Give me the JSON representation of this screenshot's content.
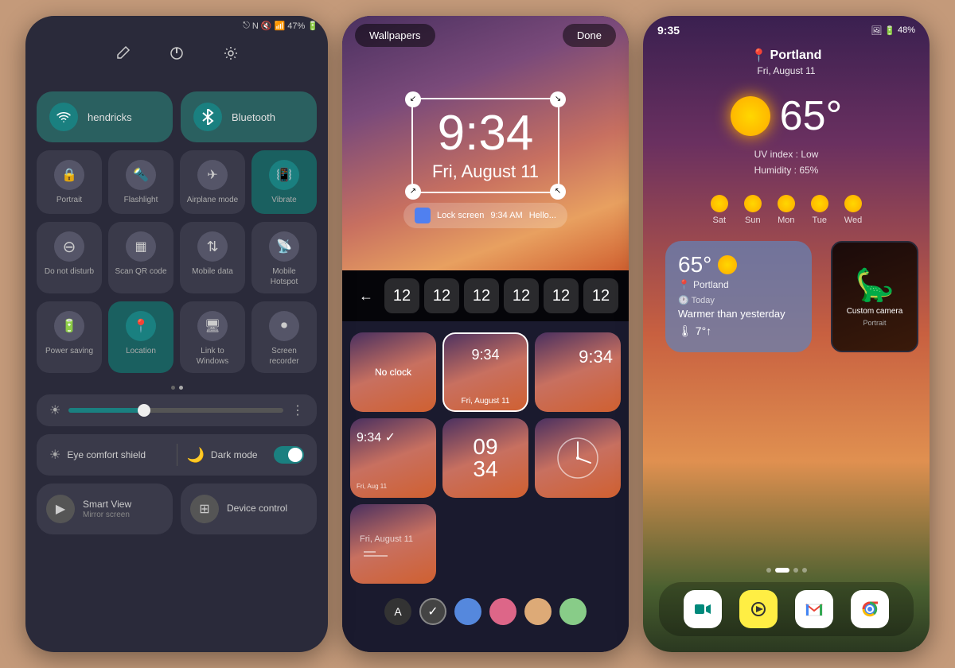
{
  "phone1": {
    "status": {
      "battery": "47%",
      "icons": [
        "bluetooth",
        "nfc",
        "mute",
        "signal",
        "battery"
      ]
    },
    "toolbar": {
      "edit_label": "✏",
      "power_label": "⏻",
      "settings_label": "⚙"
    },
    "tiles_top": [
      {
        "id": "wifi",
        "label": "hendricks",
        "active": true,
        "icon": "wifi"
      },
      {
        "id": "bluetooth",
        "label": "Bluetooth",
        "active": true,
        "icon": "bluetooth"
      }
    ],
    "tiles_row1": [
      {
        "id": "portrait",
        "label": "Portrait",
        "active": false,
        "icon": "🔒"
      },
      {
        "id": "flashlight",
        "label": "Flashlight",
        "active": false,
        "icon": "🔦"
      },
      {
        "id": "airplane",
        "label": "Airplane mode",
        "active": false,
        "icon": "✈"
      },
      {
        "id": "vibrate",
        "label": "Vibrate",
        "active": true,
        "icon": "📳"
      }
    ],
    "tiles_row2": [
      {
        "id": "dnd",
        "label": "Do not disturb",
        "active": false,
        "icon": "⊖"
      },
      {
        "id": "qr",
        "label": "Scan QR code",
        "active": false,
        "icon": "▦"
      },
      {
        "id": "data",
        "label": "Mobile data",
        "active": false,
        "icon": "↕"
      },
      {
        "id": "hotspot",
        "label": "Mobile Hotspot",
        "active": false,
        "icon": "📶"
      }
    ],
    "tiles_row3": [
      {
        "id": "power",
        "label": "Power saving",
        "active": false,
        "icon": "🔋"
      },
      {
        "id": "location",
        "label": "Location",
        "active": true,
        "icon": "📍"
      },
      {
        "id": "link",
        "label": "Link to Windows",
        "active": false,
        "icon": "🖥"
      },
      {
        "id": "recorder",
        "label": "Screen recorder",
        "active": false,
        "icon": "⏺"
      }
    ],
    "brightness": {
      "level": 35,
      "dots": [
        false,
        true
      ]
    },
    "comfort": {
      "eye_label": "Eye comfort shield",
      "dark_label": "Dark mode"
    },
    "bottom": [
      {
        "id": "smart_view",
        "label": "Smart View",
        "sub": "Mirror screen",
        "icon": "▶"
      },
      {
        "id": "device_control",
        "label": "Device control",
        "icon": "⊞"
      }
    ]
  },
  "phone2": {
    "top_bar": {
      "wallpapers_label": "Wallpapers",
      "done_label": "Done"
    },
    "clock_display": {
      "time": "9:34",
      "date": "Fri, August 11"
    },
    "lockscreen_notif": {
      "app": "Lock screen",
      "time": "9:34 AM",
      "text": "Hello..."
    },
    "scroll_numbers": [
      "12",
      "12",
      "12",
      "12",
      "12",
      "12"
    ],
    "clock_options": [
      {
        "id": "no_clock",
        "label": "No clock",
        "type": "empty"
      },
      {
        "id": "digital1",
        "label": "",
        "time": "9:34",
        "date": "Fri, August 11",
        "type": "digital_small"
      },
      {
        "id": "digital2",
        "label": "",
        "time": "9:34",
        "type": "digital_right"
      },
      {
        "id": "datetime3",
        "label": "",
        "time": "9:34",
        "date": "Fri, Aug...",
        "type": "digital_left"
      },
      {
        "id": "stacked",
        "label": "",
        "time1": "09",
        "time2": "34",
        "type": "stacked"
      },
      {
        "id": "analog",
        "label": "",
        "type": "analog"
      },
      {
        "id": "minimal",
        "label": "",
        "type": "minimal"
      }
    ],
    "colors": [
      {
        "id": "letter",
        "value": "#333333",
        "letter": "A"
      },
      {
        "id": "check",
        "value": "#444444",
        "check": true
      },
      {
        "id": "blue",
        "value": "#5588dd"
      },
      {
        "id": "pink",
        "value": "#dd6688"
      },
      {
        "id": "peach",
        "value": "#ddaa77"
      },
      {
        "id": "green",
        "value": "#88cc88"
      }
    ]
  },
  "phone3": {
    "status": {
      "time": "9:35",
      "battery": "48%"
    },
    "weather": {
      "location": "Portland",
      "date": "Fri, August 11",
      "temp": "65°",
      "uv": "UV index : Low",
      "humidity": "Humidity : 65%",
      "forecast": [
        {
          "day": "Sat"
        },
        {
          "day": "Sun"
        },
        {
          "day": "Mon"
        },
        {
          "day": "Tue"
        },
        {
          "day": "Wed"
        }
      ]
    },
    "weather_card": {
      "temp": "65°",
      "location": "Portland",
      "period": "Today",
      "description": "Warmer than yesterday",
      "change": "7°↑"
    },
    "mini_camera": {
      "label": "Custom camera",
      "sub": "Portrait"
    },
    "dock_apps": [
      {
        "id": "meet",
        "emoji": "📹",
        "label": "Meet"
      },
      {
        "id": "reels",
        "emoji": "⭐",
        "label": "Reels"
      },
      {
        "id": "gmail",
        "emoji": "✉",
        "label": "Gmail"
      },
      {
        "id": "chrome",
        "emoji": "🌐",
        "label": "Chrome"
      }
    ]
  }
}
